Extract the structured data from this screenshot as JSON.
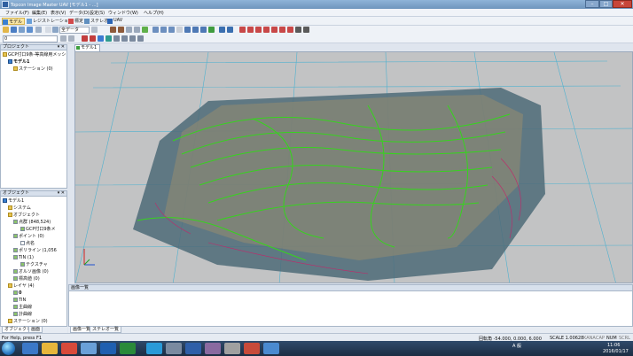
{
  "window": {
    "title": "Topcon Image Master UAV  [モデル1 - ...]"
  },
  "titlebar_buttons": {
    "minimize": "–",
    "maximize": "□",
    "close": "✕"
  },
  "menu": [
    "ファイル(F)",
    "編集(E)",
    "表示(V)",
    "データ(D)",
    "設定(S)",
    "ウィンドウ(W)",
    "ヘルプ(H)"
  ],
  "modes": [
    "モデル",
    "レジストレーション",
    "標定",
    "ステレオ",
    "UAV"
  ],
  "toolbar": {
    "layer_combo": "全データ",
    "value_combo": "0"
  },
  "project_panel": {
    "title": "プロジェクト",
    "items": [
      "GCP付口9条-等高線用メッシ",
      "モデル1",
      "ステーション (0)"
    ]
  },
  "object_panel": {
    "title": "オブジェクト",
    "items": [
      "モデル1",
      "システム",
      "オブジェクト",
      "点群 (848,524)",
      "GCP付口9条メ",
      "ポイント (0)",
      "点名",
      "ポリライン (1,056",
      "TIN (1)",
      "テクスチャ",
      "オルソ画像 (0)",
      "標高値 (0)",
      "レイヤ (4)",
      "0",
      "TIN",
      "主曲線",
      "計曲線",
      "ステーション (0)"
    ]
  },
  "document_tab": "モデル1",
  "bottom_panel": {
    "title": "画像一覧",
    "tabs": [
      "画像一覧",
      "ステレオ一覧"
    ]
  },
  "left_tabs": [
    "オブジェクト",
    "画面"
  ],
  "status": {
    "help": "For Help, press F1",
    "rotation": "回転角 -54.000, 0.000, 6.000",
    "scale": "SCALE 1.00628",
    "flags": [
      "KANA",
      "CAP",
      "NUM",
      "SCRL"
    ]
  },
  "taskbar": {
    "lang": "A 般",
    "time": "11:06",
    "date": "2016/01/17"
  },
  "colors": {
    "contour_green": "#36d41d",
    "contour_red": "#c2276a",
    "grid": "#4fb1cf",
    "viewport_bg": "#c2c3c4"
  }
}
